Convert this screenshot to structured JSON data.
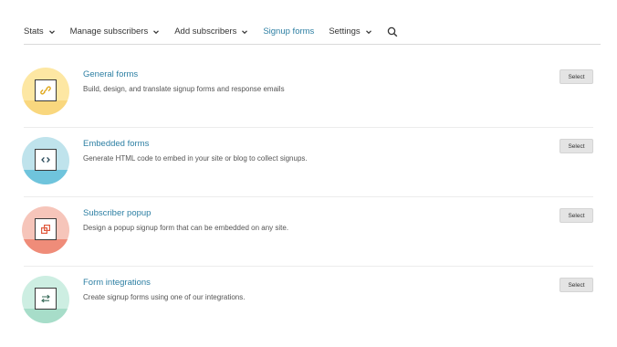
{
  "nav": {
    "items": [
      {
        "label": "Stats",
        "dropdown": true,
        "active": false
      },
      {
        "label": "Manage subscribers",
        "dropdown": true,
        "active": false
      },
      {
        "label": "Add subscribers",
        "dropdown": true,
        "active": false
      },
      {
        "label": "Signup forms",
        "dropdown": false,
        "active": true
      },
      {
        "label": "Settings",
        "dropdown": true,
        "active": false
      }
    ],
    "search_icon": "search-icon"
  },
  "forms": [
    {
      "title": "General forms",
      "description": "Build, design, and translate signup forms and response emails",
      "button": "Select",
      "icon": "link-icon",
      "circle_color": "#fde7a3",
      "half_color": "#f9d77e",
      "icon_color": "#e0a91f"
    },
    {
      "title": "Embedded forms",
      "description": "Generate HTML code to embed in your site or blog to collect signups.",
      "button": "Select",
      "icon": "code-icon",
      "circle_color": "#bfe3ec",
      "half_color": "#6fc4dc",
      "icon_color": "#2a4a5a"
    },
    {
      "title": "Subscriber popup",
      "description": "Design a popup signup form that can be embedded on any site.",
      "button": "Select",
      "icon": "popup-icon",
      "circle_color": "#f6c5ba",
      "half_color": "#ef8c79",
      "icon_color": "#e05a3f"
    },
    {
      "title": "Form integrations",
      "description": "Create signup forms using one of our integrations.",
      "button": "Select",
      "icon": "swap-arrows-icon",
      "circle_color": "#cdeee2",
      "half_color": "#a7ddc9",
      "icon_color": "#3a6b5a"
    }
  ]
}
